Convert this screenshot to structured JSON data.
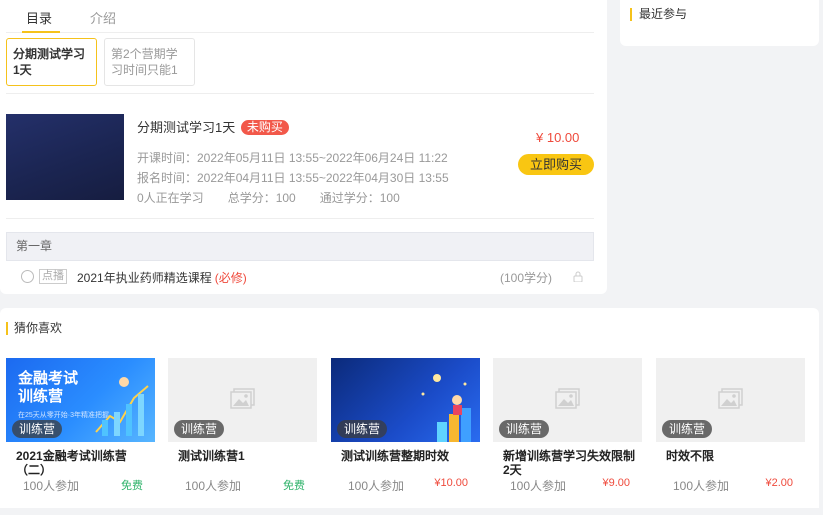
{
  "tabs": [
    {
      "label": "目录"
    },
    {
      "label": "介绍"
    }
  ],
  "sidebar": {
    "title": "最近参与"
  },
  "camp_tabs": [
    {
      "label": "分期测试学习1天"
    },
    {
      "label": "第2个营期学习时间只能1"
    }
  ],
  "course": {
    "title": "分期测试学习1天",
    "status_badge": "未购买",
    "class_time": "开课时间：2022年05月11日 13:55~2022年06月24日 11:22",
    "signup_time": "报名时间：2022年04月11日 13:55~2022年04月30日 13:55",
    "learners": "0人正在学习",
    "total_credit": "总学分：100",
    "pass_credit": "通过学分：100",
    "price": "¥ 10.00",
    "buy_label": "立即购买"
  },
  "chapter": {
    "title": "第一章"
  },
  "lesson": {
    "tag": "点播",
    "name": "2021年执业药师精选课程",
    "required": "(必修)",
    "credit": "(100学分)"
  },
  "recommend": {
    "title": "猜你喜欢",
    "items": [
      {
        "badge": "训练营",
        "title": "2021金融考试训练营（二）",
        "count": "100人参加",
        "price": "免费",
        "free": true,
        "image": "blue-promo",
        "promo_title": "金融考试训练营",
        "promo_sub": "在25天从零开始·3年精准把握"
      },
      {
        "badge": "训练营",
        "title": "测试训练营1",
        "count": "100人参加",
        "price": "免费",
        "free": true,
        "image": "placeholder"
      },
      {
        "badge": "训练营",
        "title": "测试训练营整期时效",
        "count": "100人参加",
        "price": "¥10.00",
        "free": false,
        "image": "blue-night"
      },
      {
        "badge": "训练营",
        "title": "新增训练营学习失效限制2天",
        "count": "100人参加",
        "price": "¥9.00",
        "free": false,
        "image": "placeholder"
      },
      {
        "badge": "训练营",
        "title": "时效不限",
        "count": "100人参加",
        "price": "¥2.00",
        "free": false,
        "image": "placeholder"
      }
    ]
  },
  "colors": {
    "accent": "#f5c21b",
    "price": "#ef4a3c",
    "free": "#30b36b",
    "buy_button": "#f9c612"
  }
}
